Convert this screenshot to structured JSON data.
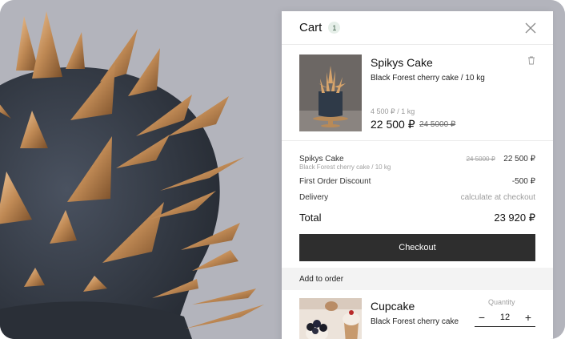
{
  "cart": {
    "title": "Cart",
    "count": "1"
  },
  "item": {
    "name": "Spikys Cake",
    "description": "Black Forest cherry cake / 10 kg",
    "unit_price": "4 500 ₽ / 1 kg",
    "price": "22 500 ₽",
    "old_price": "24 5000 ₽"
  },
  "summary": {
    "item_name": "Spikys Cake",
    "item_sub": "Black Forest cherry cake / 10 kg",
    "item_old": "24 5000 ₽",
    "item_price": "22 500 ₽",
    "discount_label": "First Order Discount",
    "discount_value": "-500 ₽",
    "delivery_label": "Delivery",
    "delivery_value": "calculate at checkout",
    "total_label": "Total",
    "total_value": "23 920 ₽"
  },
  "checkout_label": "Checkout",
  "add_to_order_label": "Add to order",
  "upsell": {
    "name": "Cupcake",
    "description": "Black Forest cherry cake",
    "quantity_label": "Quantity",
    "quantity": "12",
    "minus": "−",
    "plus": "+"
  },
  "icons": {
    "close": "close-icon",
    "trash": "trash-icon"
  },
  "colors": {
    "checkout_button": "#2e2e2e",
    "badge_bg": "#e6efe9",
    "accent_gold": "#c08a55"
  }
}
